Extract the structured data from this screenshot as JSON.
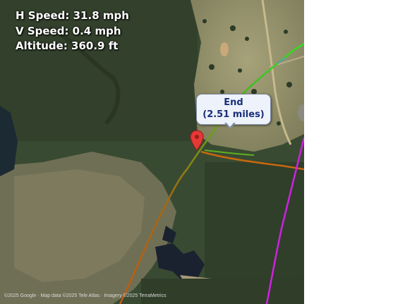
{
  "hud": {
    "h_speed": "H Speed: 31.8 mph",
    "v_speed": "V Speed: 0.4 mph",
    "altitude": "Altitude: 360.9 ft"
  },
  "marker": {
    "title": "End",
    "distance": "(2.51 miles)",
    "icon": "map-pin-icon",
    "color": "#e53935"
  },
  "attribution": "©2025 Google · Map data ©2025 Tele Atlas · Imagery ©2025 TerraMetrics",
  "colors": {
    "track_start": "#c06010",
    "track_mid": "#7aa010",
    "track_end": "#3cd620",
    "secondary_track": "#d020e0",
    "orange_track": "#d07010"
  }
}
